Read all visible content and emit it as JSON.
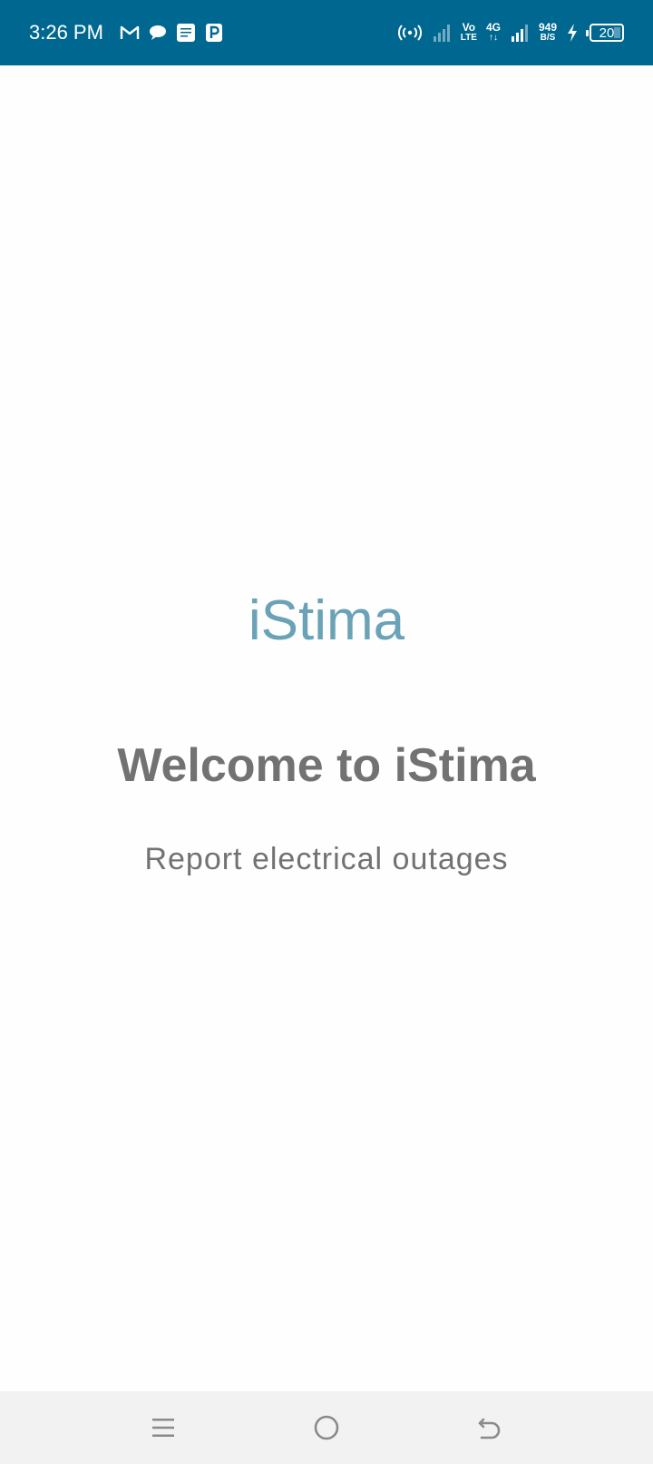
{
  "status_bar": {
    "time": "3:26 PM",
    "left_icons": [
      "gmail-icon",
      "message-bubble-icon",
      "news-app-icon",
      "parking-app-icon"
    ],
    "hotspot": "hotspot-icon",
    "volte_top": "Vo",
    "volte_bottom": "LTE",
    "network_top": "4G",
    "network_bottom": "↑↓",
    "speed_value": "949",
    "speed_unit": "B/S",
    "battery_level": "20",
    "charging": "charging-bolt-icon",
    "colors": {
      "background": "#006890",
      "foreground": "#ffffff"
    }
  },
  "main": {
    "app_name": "iStima",
    "welcome": "Welcome to iStima",
    "tagline": "Report electrical outages",
    "colors": {
      "app_name": "#6aa3b7",
      "text": "#727272",
      "background": "#fefefe"
    }
  },
  "nav_bar": {
    "buttons": [
      "menu-icon",
      "home-icon",
      "back-icon"
    ],
    "colors": {
      "background": "#f2f2f2",
      "icon": "#8a8a8a"
    }
  }
}
